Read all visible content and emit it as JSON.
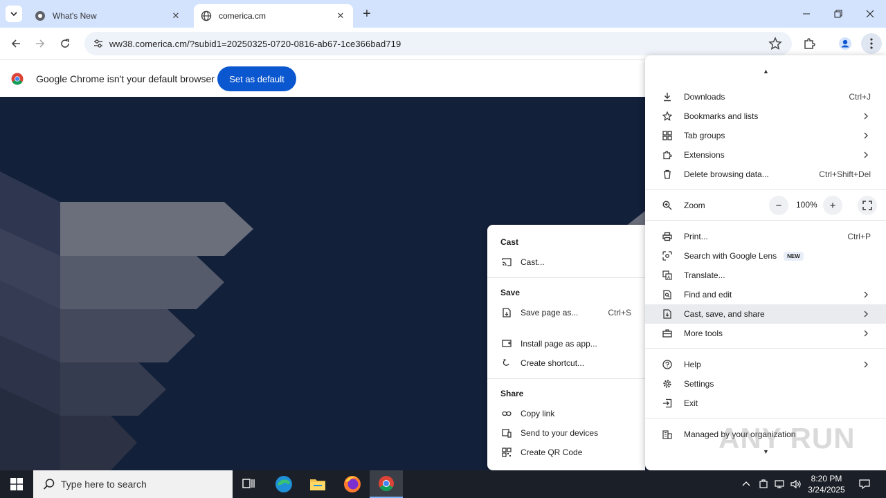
{
  "tabs": [
    {
      "title": "What's New",
      "active": false
    },
    {
      "title": "comerica.cm",
      "active": true
    }
  ],
  "toolbar": {
    "url": "ww38.comerica.cm/?subid1=20250325-0720-0816-ab67-1ce366bad719"
  },
  "infobar": {
    "message": "Google Chrome isn't your default browser",
    "button_label": "Set as default"
  },
  "submenu": {
    "sections": [
      {
        "title": "Cast",
        "items": [
          {
            "label": "Cast...",
            "icon": "cast-icon",
            "shortcut": ""
          }
        ]
      },
      {
        "title": "Save",
        "items": [
          {
            "label": "Save page as...",
            "icon": "save-page-icon",
            "shortcut": "Ctrl+S"
          },
          {
            "label": "Install page as app...",
            "icon": "install-app-icon",
            "shortcut": ""
          },
          {
            "label": "Create shortcut...",
            "icon": "shortcut-icon",
            "shortcut": ""
          }
        ]
      },
      {
        "title": "Share",
        "items": [
          {
            "label": "Copy link",
            "icon": "link-icon",
            "shortcut": ""
          },
          {
            "label": "Send to your devices",
            "icon": "devices-icon",
            "shortcut": ""
          },
          {
            "label": "Create QR Code",
            "icon": "qr-code-icon",
            "shortcut": ""
          }
        ]
      }
    ]
  },
  "menu": {
    "items": [
      {
        "label": "Downloads",
        "icon": "download-icon",
        "shortcut": "Ctrl+J"
      },
      {
        "label": "Bookmarks and lists",
        "icon": "star-icon",
        "submenu": true
      },
      {
        "label": "Tab groups",
        "icon": "tab-groups-icon",
        "submenu": true
      },
      {
        "label": "Extensions",
        "icon": "extensions-icon",
        "submenu": true
      },
      {
        "label": "Delete browsing data...",
        "icon": "trash-icon",
        "shortcut": "Ctrl+Shift+Del"
      },
      {
        "label": "Zoom",
        "icon": "zoom-icon"
      },
      {
        "label": "Print...",
        "icon": "print-icon",
        "shortcut": "Ctrl+P"
      },
      {
        "label": "Search with Google Lens",
        "icon": "lens-icon",
        "badge": "NEW"
      },
      {
        "label": "Translate...",
        "icon": "translate-icon"
      },
      {
        "label": "Find and edit",
        "icon": "find-icon",
        "submenu": true
      },
      {
        "label": "Cast, save, and share",
        "icon": "cast-save-share-icon",
        "submenu": true,
        "highlighted": true
      },
      {
        "label": "More tools",
        "icon": "toolbox-icon",
        "submenu": true
      },
      {
        "label": "Help",
        "icon": "help-icon",
        "submenu": true
      },
      {
        "label": "Settings",
        "icon": "gear-icon"
      },
      {
        "label": "Exit",
        "icon": "exit-icon"
      },
      {
        "label": "Managed by your organization",
        "icon": "building-icon"
      }
    ],
    "zoom": {
      "minus": "−",
      "value": "100%",
      "plus": "+"
    }
  },
  "watermark": "ANY RUN",
  "taskbar": {
    "search_placeholder": "Type here to search",
    "apps": [
      "task-view-icon",
      "edge-icon",
      "file-explorer-icon",
      "firefox-icon",
      "chrome-icon"
    ],
    "time": "8:20 PM",
    "date": "3/24/2025"
  }
}
